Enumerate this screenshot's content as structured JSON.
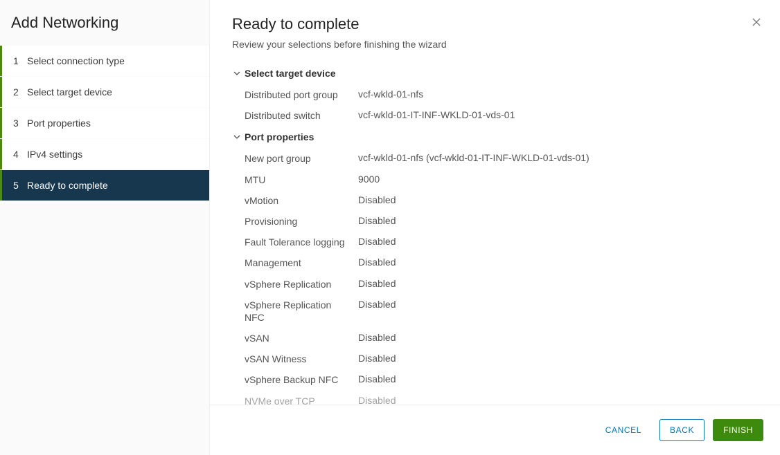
{
  "sidebar": {
    "title": "Add Networking",
    "steps": [
      {
        "num": "1",
        "label": "Select connection type"
      },
      {
        "num": "2",
        "label": "Select target device"
      },
      {
        "num": "3",
        "label": "Port properties"
      },
      {
        "num": "4",
        "label": "IPv4 settings"
      },
      {
        "num": "5",
        "label": "Ready to complete"
      }
    ]
  },
  "header": {
    "title": "Ready to complete",
    "subtitle": "Review your selections before finishing the wizard"
  },
  "sections": {
    "targetDevice": {
      "title": "Select target device",
      "rows": [
        {
          "k": "Distributed port group",
          "v": "vcf-wkld-01-nfs"
        },
        {
          "k": "Distributed switch",
          "v": "vcf-wkld-01-IT-INF-WKLD-01-vds-01"
        }
      ]
    },
    "portProperties": {
      "title": "Port properties",
      "rows": [
        {
          "k": "New port group",
          "v": "vcf-wkld-01-nfs (vcf-wkld-01-IT-INF-WKLD-01-vds-01)"
        },
        {
          "k": "MTU",
          "v": "9000"
        },
        {
          "k": "vMotion",
          "v": "Disabled"
        },
        {
          "k": "Provisioning",
          "v": "Disabled"
        },
        {
          "k": "Fault Tolerance logging",
          "v": "Disabled"
        },
        {
          "k": "Management",
          "v": "Disabled"
        },
        {
          "k": "vSphere Replication",
          "v": "Disabled"
        },
        {
          "k": "vSphere Replication NFC",
          "v": "Disabled"
        },
        {
          "k": "vSAN",
          "v": "Disabled"
        },
        {
          "k": "vSAN Witness",
          "v": "Disabled"
        },
        {
          "k": "vSphere Backup NFC",
          "v": "Disabled"
        },
        {
          "k": "NVMe over TCP",
          "v": "Disabled"
        }
      ]
    }
  },
  "footer": {
    "cancel": "CANCEL",
    "back": "BACK",
    "finish": "FINISH"
  }
}
